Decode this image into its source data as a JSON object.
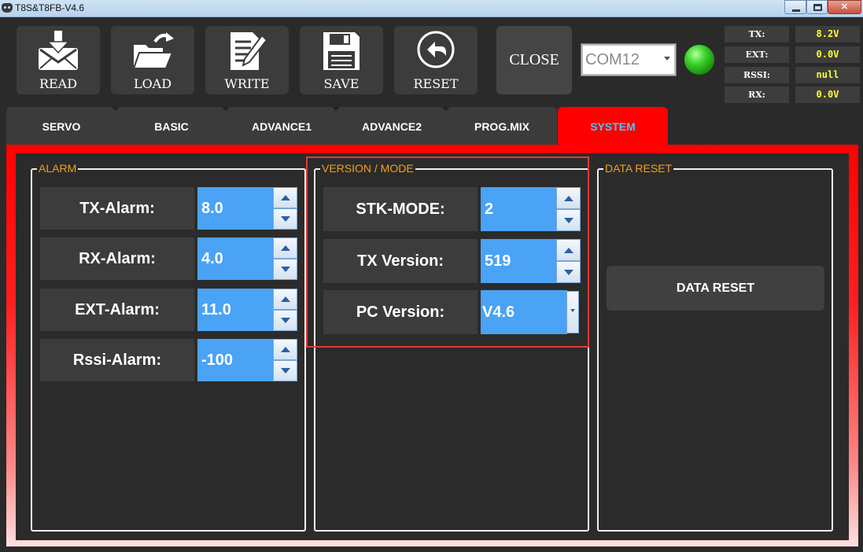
{
  "window": {
    "title": "T8S&T8FB-V4.6"
  },
  "toolbar": {
    "read_label": "READ",
    "load_label": "LOAD",
    "write_label": "WRITE",
    "save_label": "SAVE",
    "reset_label": "RESET",
    "close_label": "CLOSE"
  },
  "connection": {
    "port": "COM12",
    "status_color": "#3ad42a"
  },
  "telemetry": [
    {
      "label": "TX:",
      "value": "8.2V"
    },
    {
      "label": "EXT:",
      "value": "0.0V"
    },
    {
      "label": "RSSI:",
      "value": "null"
    },
    {
      "label": "RX:",
      "value": "0.0V"
    }
  ],
  "tabs": [
    {
      "label": "SERVO"
    },
    {
      "label": "BASIC"
    },
    {
      "label": "ADVANCE1"
    },
    {
      "label": "ADVANCE2"
    },
    {
      "label": "PROG.MIX"
    },
    {
      "label": "SYSTEM"
    }
  ],
  "active_tab": "SYSTEM",
  "colors": {
    "accent_red": "#ff0000",
    "value_blue": "#4aa3f5",
    "group_title": "#f0a020",
    "active_tab_text": "#4fc3f7",
    "telemetry_value": "#ffff33"
  },
  "alarm": {
    "title": "ALARM",
    "rows": [
      {
        "label": "TX-Alarm:",
        "value": "8.0"
      },
      {
        "label": "RX-Alarm:",
        "value": "4.0"
      },
      {
        "label": "EXT-Alarm:",
        "value": "11.0"
      },
      {
        "label": "Rssi-Alarm:",
        "value": "-100"
      }
    ]
  },
  "version": {
    "title": "VERSION / MODE",
    "rows": [
      {
        "label": "STK-MODE:",
        "value": "2"
      },
      {
        "label": "TX Version:",
        "value": "519"
      },
      {
        "label": "PC Version:",
        "value": "V4.6"
      }
    ]
  },
  "data_reset": {
    "title": "DATA RESET",
    "button_label": "DATA RESET"
  }
}
